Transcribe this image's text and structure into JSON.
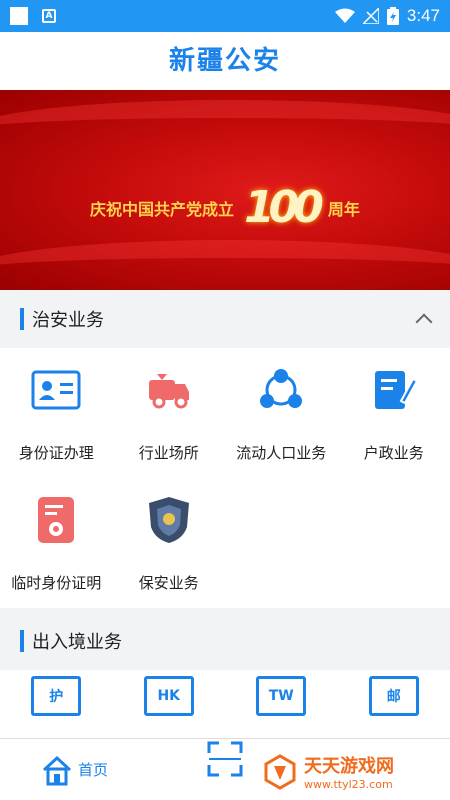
{
  "status_bar": {
    "time": "3:47"
  },
  "app_title": "新疆公安",
  "banner": {
    "left_text": "庆祝中国共产党成立",
    "number": "100",
    "right_text": "周年"
  },
  "section_security": {
    "title": "治安业务",
    "items": [
      {
        "label": "身份证办理"
      },
      {
        "label": "行业场所"
      },
      {
        "label": "流动人口业务"
      },
      {
        "label": "户政业务"
      },
      {
        "label": "临时身份证明"
      },
      {
        "label": "保安业务"
      }
    ]
  },
  "section_exit": {
    "title": "出入境业务",
    "items": [
      {
        "label": "护"
      },
      {
        "label": "HK"
      },
      {
        "label": "TW"
      },
      {
        "label": "邮"
      }
    ]
  },
  "bottom_nav": {
    "home_label": "首页"
  },
  "watermark": {
    "name": "天天游戏网",
    "url": "www.ttyl23.com"
  },
  "colors": {
    "primary": "#1a82e8",
    "status": "#2196f3",
    "banner": "#c40b0b"
  }
}
